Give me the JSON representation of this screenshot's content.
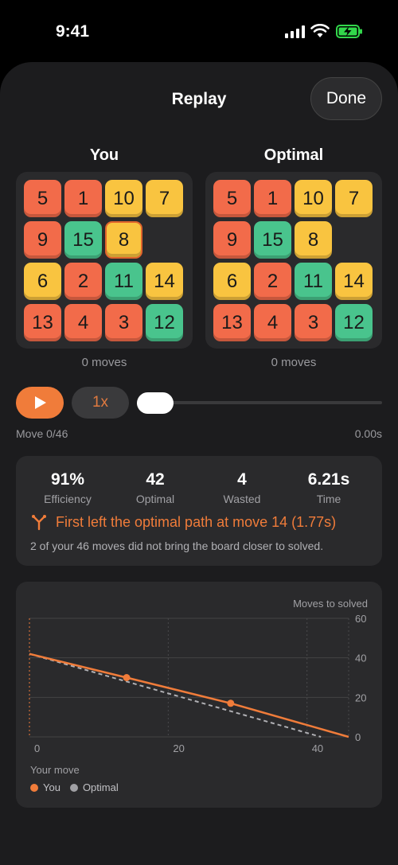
{
  "status_bar": {
    "time": "9:41"
  },
  "header": {
    "title": "Replay",
    "done_label": "Done"
  },
  "boards": [
    {
      "label": "You",
      "moves_text": "0 moves",
      "tiles": [
        {
          "n": "5",
          "c": "red"
        },
        {
          "n": "1",
          "c": "red"
        },
        {
          "n": "10",
          "c": "yel"
        },
        {
          "n": "7",
          "c": "yel"
        },
        {
          "n": "9",
          "c": "red"
        },
        {
          "n": "15",
          "c": "grn"
        },
        {
          "n": "8",
          "c": "yel",
          "selected": true
        },
        {
          "n": "",
          "c": "empty"
        },
        {
          "n": "6",
          "c": "yel"
        },
        {
          "n": "2",
          "c": "red"
        },
        {
          "n": "11",
          "c": "grn"
        },
        {
          "n": "14",
          "c": "yel"
        },
        {
          "n": "13",
          "c": "red"
        },
        {
          "n": "4",
          "c": "red"
        },
        {
          "n": "3",
          "c": "red"
        },
        {
          "n": "12",
          "c": "grn"
        }
      ]
    },
    {
      "label": "Optimal",
      "moves_text": "0 moves",
      "tiles": [
        {
          "n": "5",
          "c": "red"
        },
        {
          "n": "1",
          "c": "red"
        },
        {
          "n": "10",
          "c": "yel"
        },
        {
          "n": "7",
          "c": "yel"
        },
        {
          "n": "9",
          "c": "red"
        },
        {
          "n": "15",
          "c": "grn"
        },
        {
          "n": "8",
          "c": "yel"
        },
        {
          "n": "",
          "c": "empty"
        },
        {
          "n": "6",
          "c": "yel"
        },
        {
          "n": "2",
          "c": "red"
        },
        {
          "n": "11",
          "c": "grn"
        },
        {
          "n": "14",
          "c": "yel"
        },
        {
          "n": "13",
          "c": "red"
        },
        {
          "n": "4",
          "c": "red"
        },
        {
          "n": "3",
          "c": "red"
        },
        {
          "n": "12",
          "c": "grn"
        }
      ]
    }
  ],
  "playback": {
    "speed_label": "1x",
    "move_text": "Move 0/46",
    "elapsed_text": "0.00s",
    "progress": 0
  },
  "stats": [
    {
      "value": "91%",
      "label": "Efficiency"
    },
    {
      "value": "42",
      "label": "Optimal"
    },
    {
      "value": "4",
      "label": "Wasted"
    },
    {
      "value": "6.21s",
      "label": "Time"
    }
  ],
  "deviation": {
    "text": "First left the optimal path at move 14 (1.77s)",
    "icon": "branch-icon"
  },
  "note": "2 of your 46 moves did not bring the board closer to solved.",
  "colors": {
    "accent": "#f07c3a",
    "red": "#f26b4a",
    "yellow": "#f9c440",
    "green": "#49c48d"
  },
  "chart_data": {
    "type": "line",
    "ylabel": "Moves to solved",
    "xlabel": "Your move",
    "xlim": [
      0,
      46
    ],
    "ylim": [
      0,
      60
    ],
    "x_ticks": [
      "0",
      "20",
      "40"
    ],
    "y_ticks": [
      "60",
      "40",
      "20",
      "0"
    ],
    "series": [
      {
        "name": "You",
        "color": "#f07c3a",
        "points": [
          [
            0,
            42
          ],
          [
            14,
            30
          ],
          [
            29,
            17
          ],
          [
            46,
            0
          ]
        ],
        "markers": [
          [
            14,
            30
          ],
          [
            29,
            17
          ]
        ]
      },
      {
        "name": "Optimal",
        "color": "#b0b0b4",
        "dashed": true,
        "points": [
          [
            0,
            42
          ],
          [
            42,
            0
          ]
        ]
      }
    ],
    "grid": true,
    "legend": "bottom-left"
  }
}
